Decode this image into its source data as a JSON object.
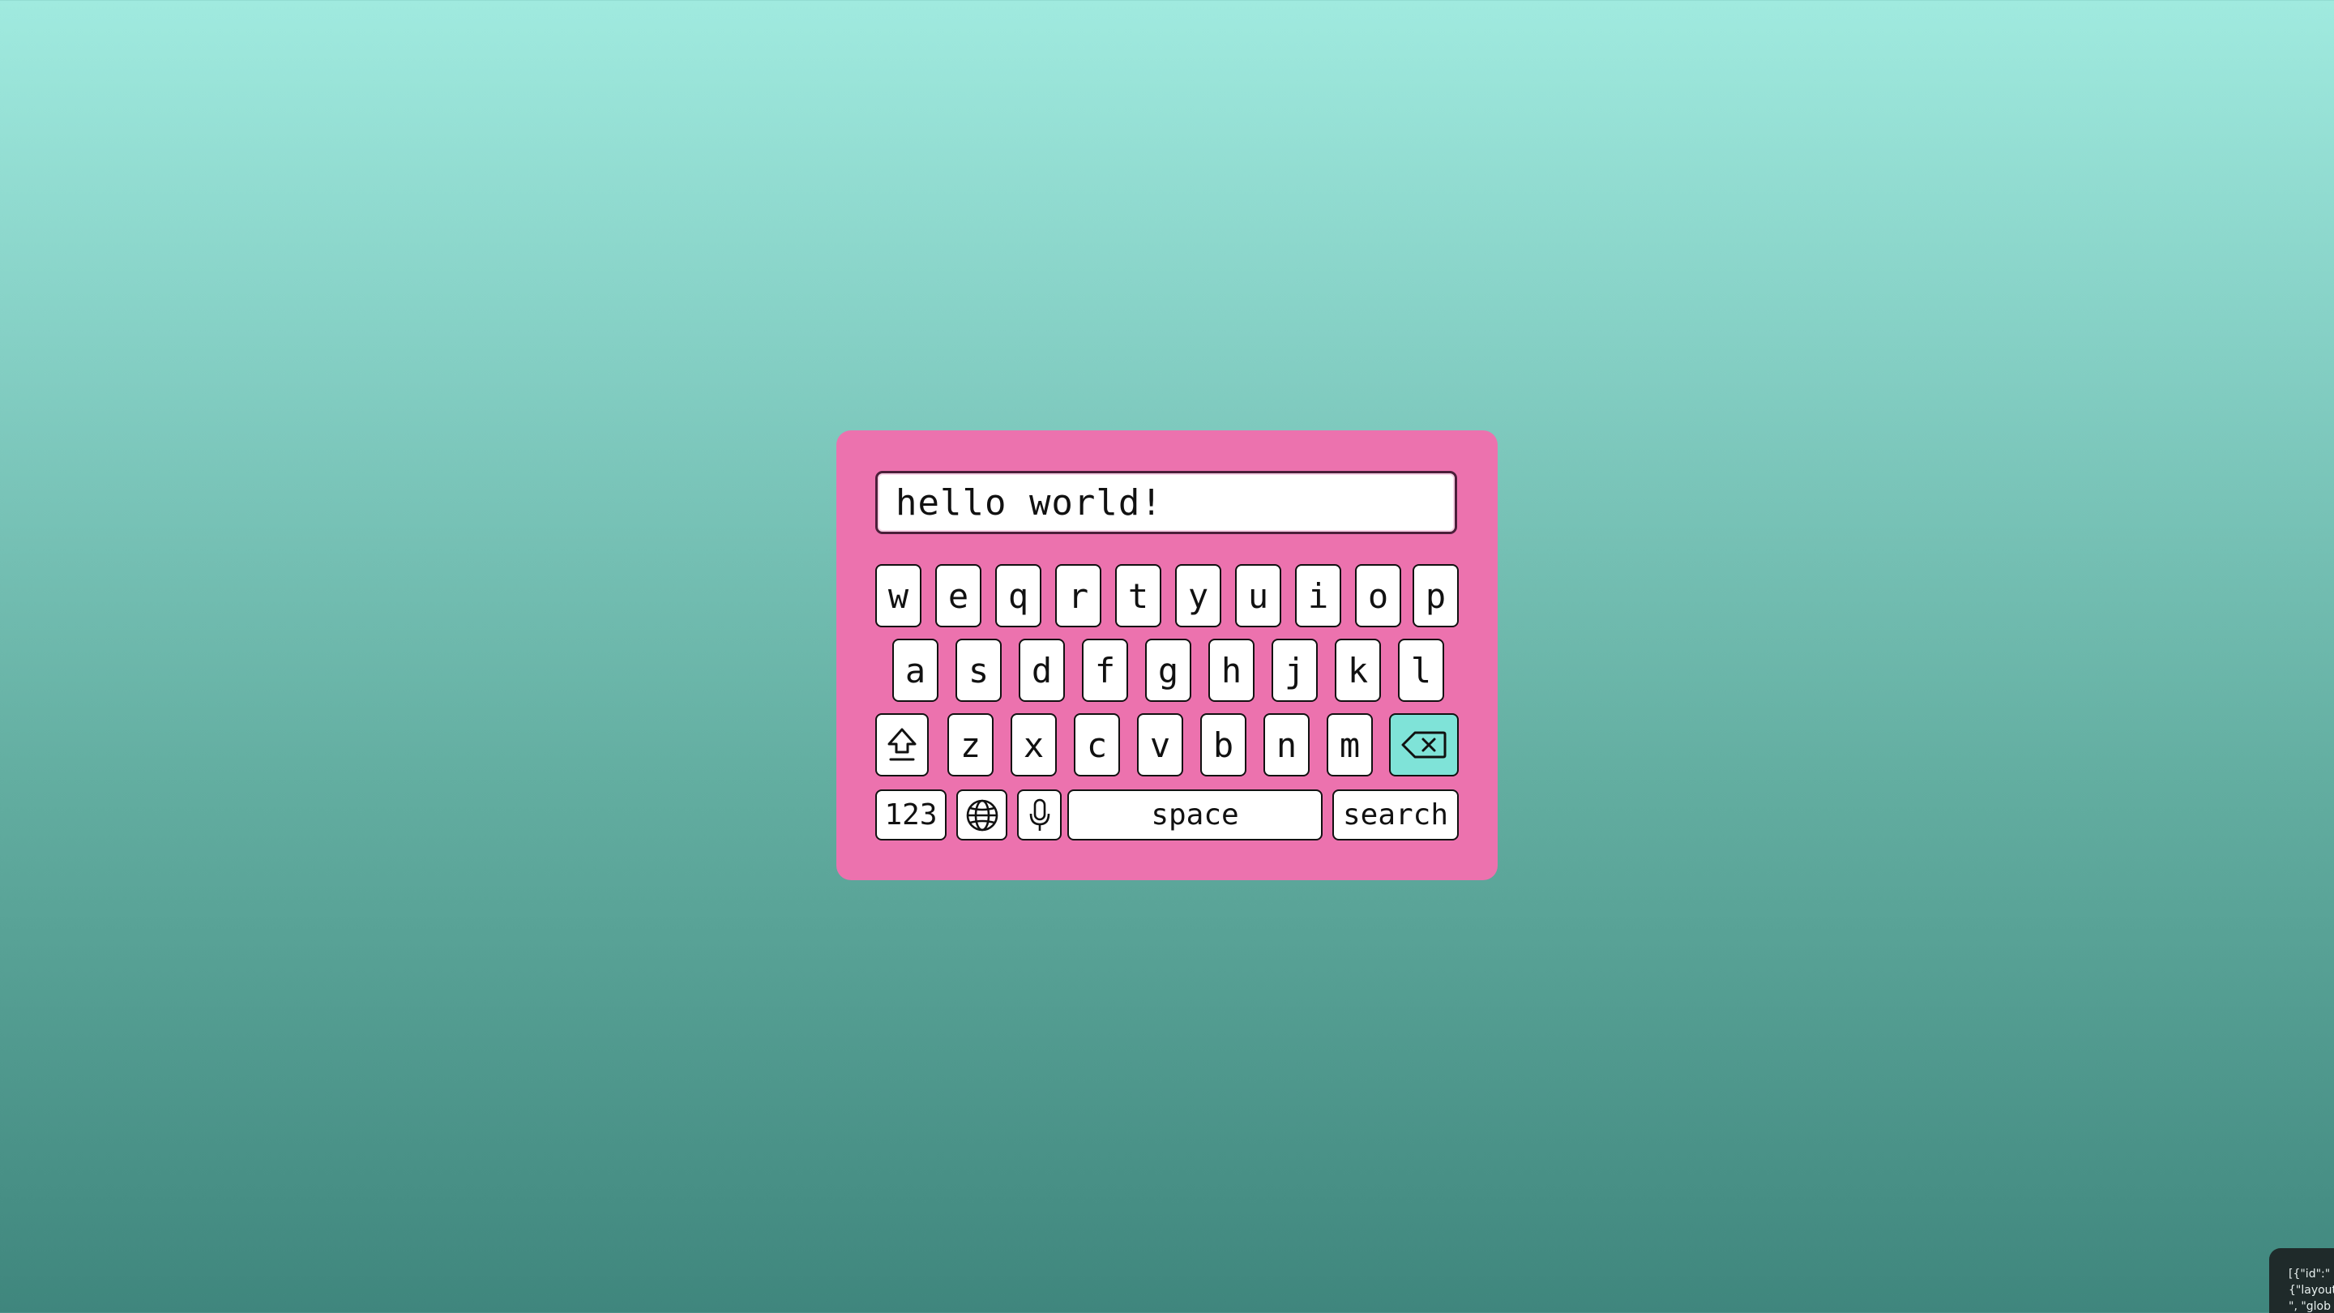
{
  "text_field": {
    "value": "hello world!"
  },
  "keyboard": {
    "row1": [
      "w",
      "e",
      "q",
      "r",
      "t",
      "y",
      "u",
      "i",
      "o",
      "p"
    ],
    "row2": [
      "a",
      "s",
      "d",
      "f",
      "g",
      "h",
      "j",
      "k",
      "l"
    ],
    "row3": [
      "z",
      "x",
      "c",
      "v",
      "b",
      "n",
      "m"
    ],
    "numbers_label": "123",
    "space_label": "space",
    "search_label": "search",
    "icons": {
      "shift": "shift-arrow-icon",
      "backspace": "backspace-icon",
      "globe": "globe-icon",
      "mic": "microphone-icon"
    }
  },
  "debug_tab": {
    "line1": "[{\"id\":\"",
    "line2": "{\"layout",
    "line3": "\", \"glob"
  },
  "colors": {
    "panel": "#ec72ae",
    "backspace_key": "#7fe3d8",
    "background_top": "#a0eadf",
    "background_bottom": "#3f867d"
  }
}
